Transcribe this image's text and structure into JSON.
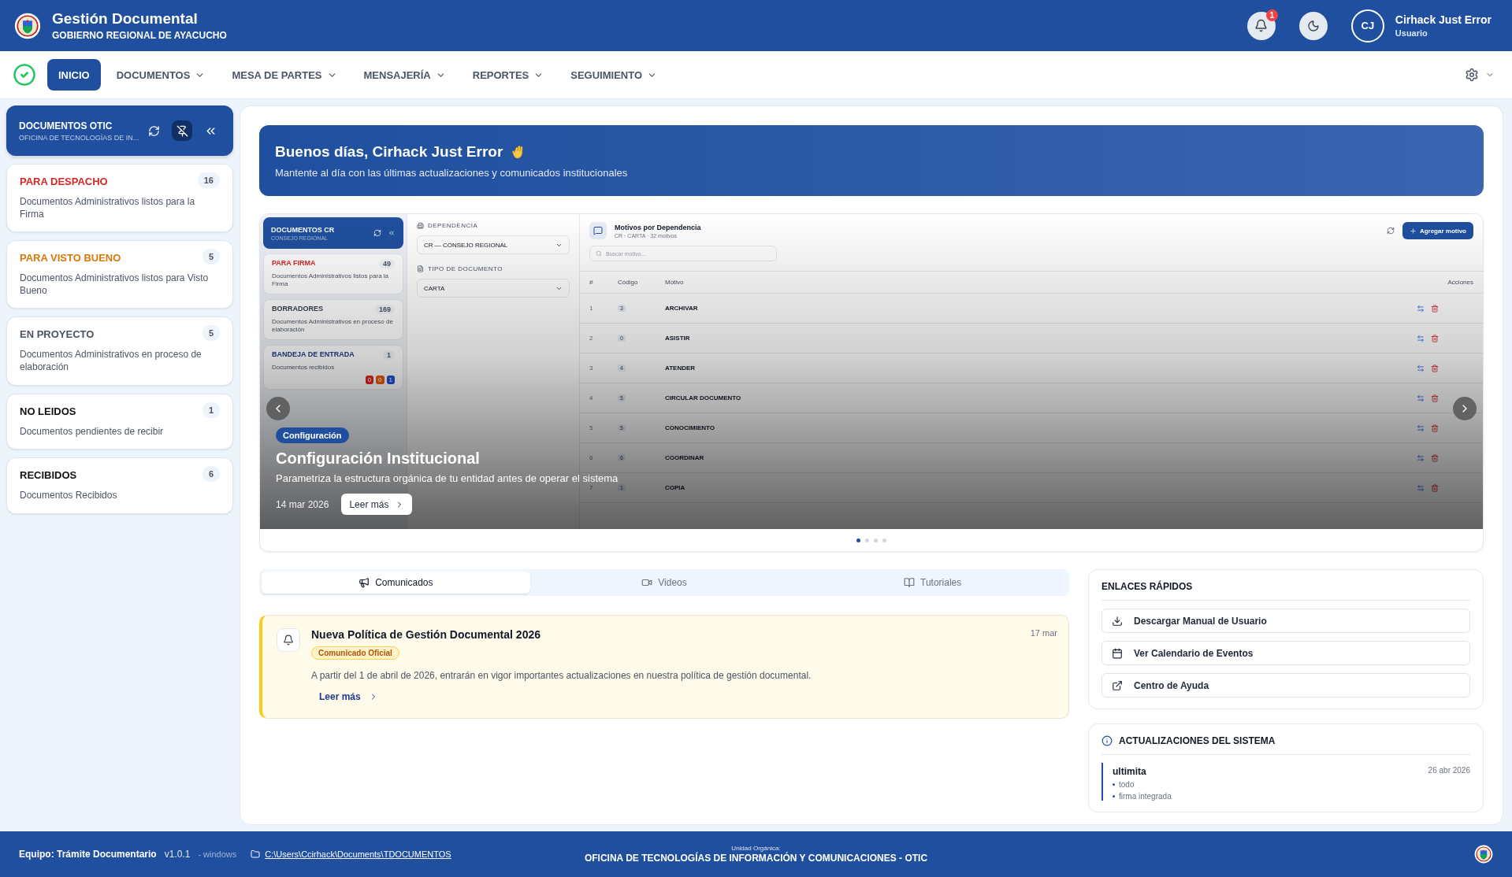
{
  "header": {
    "title": "Gestión Documental",
    "subtitle": "GOBIERNO REGIONAL DE AYACUCHO",
    "notifications": "1",
    "user": {
      "initials": "CJ",
      "name": "Cirhack Just Error",
      "role": "Usuario"
    }
  },
  "nav": {
    "items": [
      {
        "label": "INICIO",
        "selected": true,
        "dropdown": false
      },
      {
        "label": "DOCUMENTOS",
        "selected": false,
        "dropdown": true
      },
      {
        "label": "MESA DE PARTES",
        "selected": false,
        "dropdown": true
      },
      {
        "label": "MENSAJERÍA",
        "selected": false,
        "dropdown": true
      },
      {
        "label": "REPORTES",
        "selected": false,
        "dropdown": true
      },
      {
        "label": "SEGUIMIENTO",
        "selected": false,
        "dropdown": true
      }
    ]
  },
  "sidebar": {
    "title": "DOCUMENTOS OTIC",
    "subtitle": "OFICINA DE TECNOLOGÍAS DE IN...",
    "items": [
      {
        "label": "PARA DESPACHO",
        "count": "16",
        "description": "Documentos Administrativos listos para la Firma",
        "color": "#dc2626"
      },
      {
        "label": "PARA VISTO BUENO",
        "count": "5",
        "description": "Documentos Administrativos listos para Visto Bueno",
        "color": "#d97706"
      },
      {
        "label": "EN PROYECTO",
        "count": "5",
        "description": "Documentos Administrativos en proceso de elaboración",
        "color": "#4b5563"
      },
      {
        "label": "NO LEIDOS",
        "count": "1",
        "description": "Documentos pendientes de recibir",
        "color": "#111111"
      },
      {
        "label": "RECIBIDOS",
        "count": "6",
        "description": "Documentos Recibidos",
        "color": "#111111"
      }
    ]
  },
  "greeting": {
    "title": "Buenos días, Cirhack Just Error",
    "subtitle": "Mantente al día con las últimas actualizaciones y comunicados institucionales"
  },
  "carousel": {
    "slide": {
      "sidebar": {
        "title": "DOCUMENTOS CR",
        "subtitle": "CONSEJO REGIONAL",
        "items": [
          {
            "label": "PARA FIRMA",
            "count": "49",
            "description": "Documentos Administrativos listos para la Firma",
            "kind": "urgent"
          },
          {
            "label": "BORRADORES",
            "count": "169",
            "description": "Documentos Administrativos en proceso de elaboración",
            "kind": "draft"
          },
          {
            "label": "BANDEJA DE ENTRADA",
            "count": "1",
            "description": "Documentos recibidos",
            "kind": "inbox",
            "badges": [
              "0",
              "0",
              "1"
            ]
          }
        ]
      },
      "filters": [
        {
          "label": "DEPENDENCIA",
          "value": "CR — CONSEJO REGIONAL",
          "kind": "building"
        },
        {
          "label": "TIPO DE DOCUMENTO",
          "value": "CARTA",
          "kind": "file"
        }
      ],
      "table": {
        "title": "Motivos por Dependencia",
        "subtitle": "CR · CARTA · 32 motivos",
        "search_placeholder": "Buscar motivo...",
        "add_button": "Agregar motivo",
        "columns": [
          "#",
          "Código",
          "Motivo",
          "Acciones"
        ],
        "rows": [
          [
            "1",
            "3",
            "ARCHIVAR"
          ],
          [
            "2",
            "0",
            "ASISTIR"
          ],
          [
            "3",
            "4",
            "ATENDER"
          ],
          [
            "4",
            "5",
            "CIRCULAR DOCUMENTO"
          ],
          [
            "5",
            "5",
            "CONOCIMIENTO"
          ],
          [
            "6",
            "6",
            "COORDINAR"
          ],
          [
            "7",
            "1",
            "COPIA"
          ]
        ]
      }
    },
    "caption": {
      "tag": "Configuración",
      "title": "Configuración Institucional",
      "subtitle": "Parametriza la estructura orgánica de tu entidad antes de operar el sistema",
      "date": "14 mar 2026",
      "button": "Leer más"
    },
    "dots": [
      {
        "selected": true
      },
      {
        "selected": false
      },
      {
        "selected": false
      },
      {
        "selected": false
      }
    ]
  },
  "tabs": [
    {
      "label": "Comunicados",
      "kind": "megaphone",
      "selected": true
    },
    {
      "label": "Videos",
      "kind": "video",
      "selected": false
    },
    {
      "label": "Tutoriales",
      "kind": "book",
      "selected": false
    }
  ],
  "announcement": {
    "title": "Nueva Política de Gestión Documental 2026",
    "tag": "Comunicado Oficial",
    "date": "17 mar",
    "body": "A partir del 1 de abril de 2026, entrarán en vigor importantes actualizaciones en nuestra política de gestión documental.",
    "link": "Leer más"
  },
  "quick_links": {
    "title": "ENLACES RÁPIDOS",
    "items": [
      {
        "label": "Descargar Manual de Usuario",
        "kind": "download"
      },
      {
        "label": "Ver Calendario de Eventos",
        "kind": "calendar"
      },
      {
        "label": "Centro de Ayuda",
        "kind": "external"
      }
    ]
  },
  "updates": {
    "title": "ACTUALIZACIONES DEL SISTEMA",
    "entries": [
      {
        "title": "ultimita",
        "date": "26 abr 2026",
        "items": [
          "todo",
          "firma integrada"
        ]
      }
    ]
  },
  "footer": {
    "team": "Equipo: Trámite Documentario",
    "version": "v1.0.1",
    "platform": "- windows",
    "path": "C:\\Users\\Ccirhack\\Documents\\TDOCUMENTOS",
    "unit_label": "Unidad Orgánica:",
    "unit": "OFICINA DE TECNOLOGÍAS DE INFORMACIÓN Y COMUNICACIONES - OTIC"
  }
}
